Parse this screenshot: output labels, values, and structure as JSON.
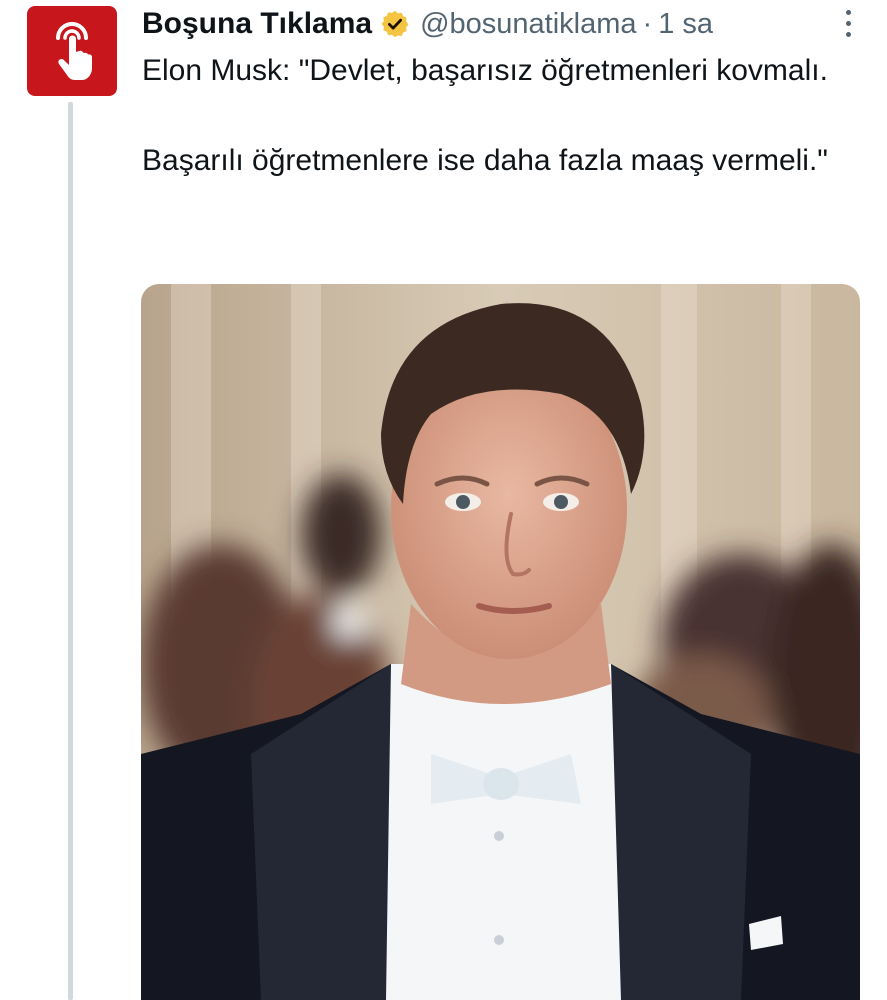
{
  "tweet": {
    "author_name": "Boşuna Tıklama",
    "handle": "@bosunatiklama",
    "separator": "·",
    "time": "1 sa",
    "verified": true,
    "verified_color": "#f4c542",
    "text_lines": [
      "Elon Musk: \"Devlet, başarısız öğretmenleri kovmalı.",
      "Başarılı öğretmenlere ise daha fazla maaş vermeli.\""
    ]
  },
  "avatar": {
    "icon": "tap-hand-icon",
    "background": "#c8161d"
  },
  "more_menu": {
    "icon": "more-vertical-icon"
  },
  "media": {
    "type": "photo",
    "subject": "man-in-tuxedo-photo"
  }
}
